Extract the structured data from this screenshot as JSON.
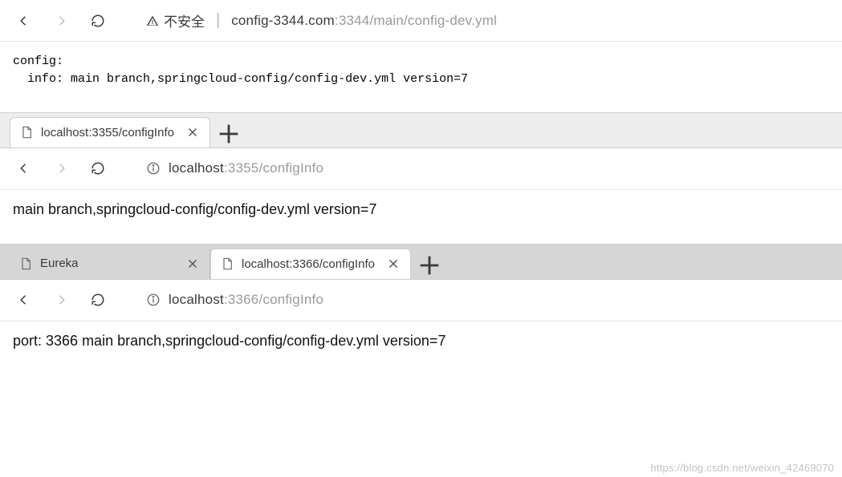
{
  "window1": {
    "insecure_label": "不安全",
    "url_host": "config-3344.com",
    "url_port": ":3344",
    "url_path": "/main/config-dev.yml",
    "body_line1": "config:",
    "body_line2": "  info: main branch,springcloud-config/config-dev.yml version=7"
  },
  "window2": {
    "tab_title": "localhost:3355/configInfo",
    "url_host": "localhost",
    "url_port": ":3355",
    "url_path": "/configInfo",
    "body": "main branch,springcloud-config/config-dev.yml version=7"
  },
  "window3": {
    "tab1_title": "Eureka",
    "tab2_title": "localhost:3366/configInfo",
    "url_host": "localhost",
    "url_port": ":3366",
    "url_path": "/configInfo",
    "body": "port: 3366 main branch,springcloud-config/config-dev.yml version=7"
  },
  "watermark": "https://blog.csdn.net/weixin_42469070"
}
